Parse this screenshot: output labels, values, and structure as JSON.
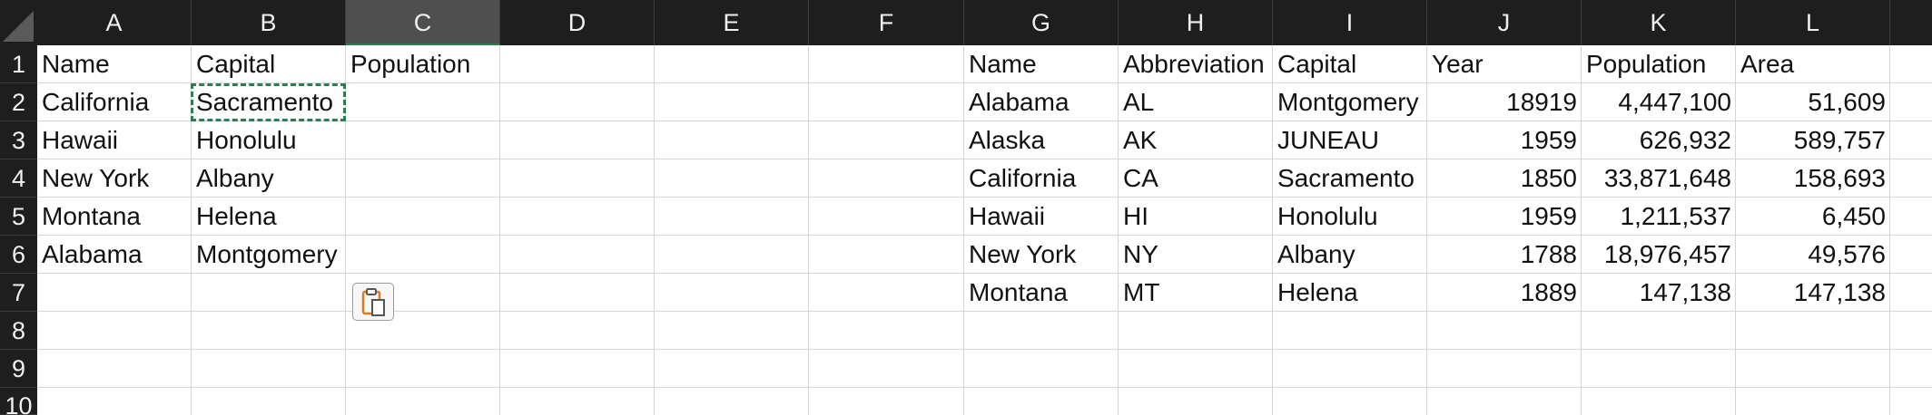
{
  "columns": [
    "A",
    "B",
    "C",
    "D",
    "E",
    "F",
    "G",
    "H",
    "I",
    "J",
    "K",
    "L"
  ],
  "rows": [
    "1",
    "2",
    "3",
    "4",
    "5",
    "6",
    "7",
    "8",
    "9",
    "10"
  ],
  "selected_column": "C",
  "copied_cell": "B2",
  "left_table": {
    "headers": [
      "Name",
      "Capital",
      "Population"
    ],
    "rows": [
      [
        "California",
        "Sacramento"
      ],
      [
        "Hawaii",
        "Honolulu"
      ],
      [
        "New York",
        "Albany"
      ],
      [
        "Montana",
        "Helena"
      ],
      [
        "Alabama",
        "Montgomery"
      ]
    ]
  },
  "right_table": {
    "headers": [
      "Name",
      "Abbreviation",
      "Capital",
      "Year",
      "Population",
      "Area"
    ],
    "rows": [
      [
        "Alabama",
        "AL",
        "Montgomery",
        "18919",
        "4,447,100",
        "51,609"
      ],
      [
        "Alaska",
        "AK",
        "JUNEAU",
        "1959",
        "626,932",
        "589,757"
      ],
      [
        "California",
        "CA",
        "Sacramento",
        "1850",
        "33,871,648",
        "158,693"
      ],
      [
        "Hawaii",
        "HI",
        "Honolulu",
        "1959",
        "1,211,537",
        "6,450"
      ],
      [
        "New York",
        "NY",
        "Albany",
        "1788",
        "18,976,457",
        "49,576"
      ],
      [
        "Montana",
        "MT",
        "Helena",
        "1889",
        "147,138",
        "147,138"
      ]
    ]
  },
  "icons": {
    "paste_options": "clipboard-icon",
    "select_all": "select-all-triangle-icon"
  },
  "colors": {
    "header_bg": "#1e1e1e",
    "selected_header_bg": "#4f4f4f",
    "copy_marquee": "#2e7d4f",
    "accent_orange": "#e07a1f"
  }
}
